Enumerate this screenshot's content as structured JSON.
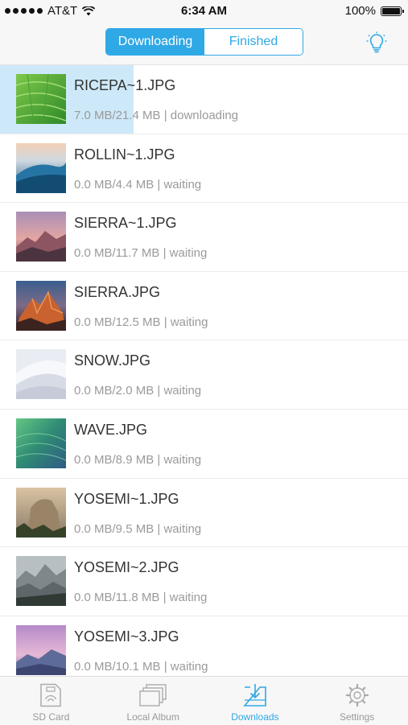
{
  "status_bar": {
    "carrier": "AT&T",
    "time": "6:34 AM",
    "battery": "100%"
  },
  "nav": {
    "segments": [
      {
        "label": "Downloading",
        "active": true
      },
      {
        "label": "Finished",
        "active": false
      }
    ],
    "tip_icon": "lightbulb-icon"
  },
  "downloads": [
    {
      "name": "RICEPA~1.JPG",
      "info": "7.0 MB/21.4 MB | downloading",
      "progress": 0.327,
      "thumb": "rice"
    },
    {
      "name": "ROLLIN~1.JPG",
      "info": "0.0 MB/4.4 MB | waiting",
      "progress": 0,
      "thumb": "wave-blue"
    },
    {
      "name": "SIERRA~1.JPG",
      "info": "0.0 MB/11.7 MB | waiting",
      "progress": 0,
      "thumb": "sierra-pink"
    },
    {
      "name": "SIERRA.JPG",
      "info": "0.0 MB/12.5 MB | waiting",
      "progress": 0,
      "thumb": "sierra-orange"
    },
    {
      "name": "SNOW.JPG",
      "info": "0.0 MB/2.0 MB | waiting",
      "progress": 0,
      "thumb": "snow"
    },
    {
      "name": "WAVE.JPG",
      "info": "0.0 MB/8.9 MB | waiting",
      "progress": 0,
      "thumb": "wave-green"
    },
    {
      "name": "YOSEMI~1.JPG",
      "info": "0.0 MB/9.5 MB | waiting",
      "progress": 0,
      "thumb": "yosemite-1"
    },
    {
      "name": "YOSEMI~2.JPG",
      "info": "0.0 MB/11.8 MB | waiting",
      "progress": 0,
      "thumb": "yosemite-2"
    },
    {
      "name": "YOSEMI~3.JPG",
      "info": "0.0 MB/10.1 MB | waiting",
      "progress": 0,
      "thumb": "yosemite-3"
    }
  ],
  "tabs": [
    {
      "label": "SD Card",
      "icon": "sd-card-icon",
      "active": false
    },
    {
      "label": "Local Album",
      "icon": "album-icon",
      "active": false
    },
    {
      "label": "Downloads",
      "icon": "download-tray-icon",
      "active": true
    },
    {
      "label": "Settings",
      "icon": "gear-icon",
      "active": false
    }
  ],
  "colors": {
    "accent": "#2fa8e6",
    "progress_fill": "#cde9f9",
    "secondary_text": "#9a9a9a"
  }
}
